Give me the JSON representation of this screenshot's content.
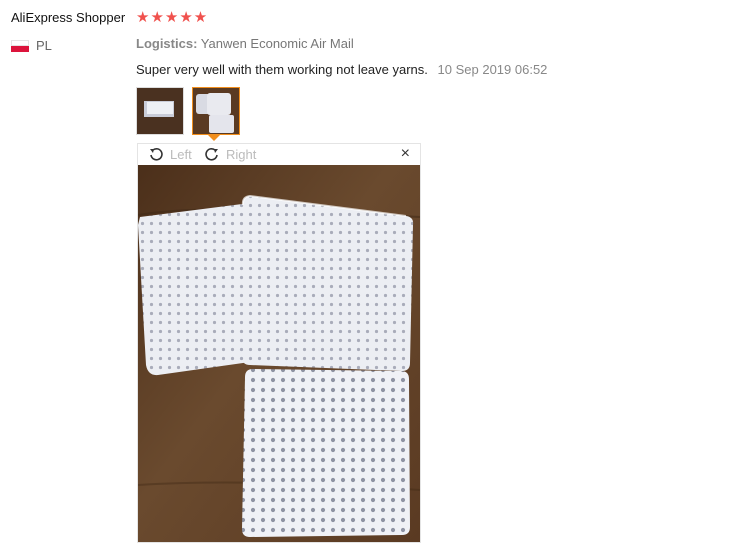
{
  "reviewer": {
    "name": "AliExpress Shopper",
    "stars": "★★★★★",
    "rating": 5,
    "country": "PL"
  },
  "review": {
    "logistics_label": "Logistics:",
    "logistics_value": "Yanwen Economic Air Mail",
    "comment": "Super very well with them working not leave yarns.",
    "date": "10 Sep 2019 06:52"
  },
  "viewer": {
    "rotate_left": "Left",
    "rotate_right": "Right",
    "close": "×"
  },
  "colors": {
    "star": "#f0514d",
    "active_thumb_border": "#f18e1c",
    "photo_background": "#5a3a22",
    "pad": "#e9e9ee"
  },
  "icons": {
    "rotate_left": "rotate-left-icon",
    "rotate_right": "rotate-right-icon",
    "close": "close-icon",
    "flag": "poland-flag-icon"
  }
}
